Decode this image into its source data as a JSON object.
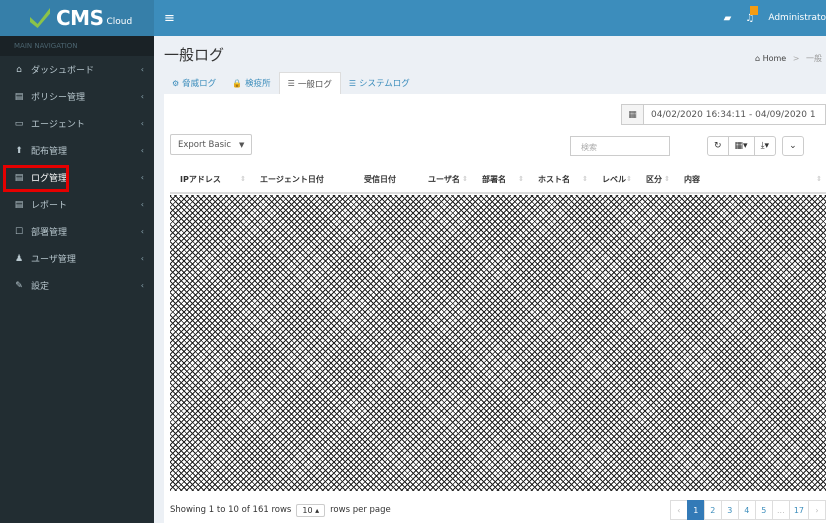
{
  "brand": {
    "name": "CMS",
    "sub": "Cloud"
  },
  "nav": {
    "header": "MAIN NAVIGATION",
    "items": [
      {
        "icon": "dashboard-icon",
        "glyph": "⌂",
        "label": "ダッシュボード",
        "chevron": "‹"
      },
      {
        "icon": "policy-icon",
        "glyph": "▤",
        "label": "ポリシー管理",
        "chevron": "‹"
      },
      {
        "icon": "agent-icon",
        "glyph": "▭",
        "label": "エージェント",
        "chevron": "‹"
      },
      {
        "icon": "deploy-icon",
        "glyph": "⬆",
        "label": "配布管理",
        "chevron": "‹"
      },
      {
        "icon": "log-icon",
        "glyph": "▤",
        "label": "ログ管理",
        "chevron": "‹"
      },
      {
        "icon": "report-icon",
        "glyph": "▤",
        "label": "レポート",
        "chevron": "‹"
      },
      {
        "icon": "department-icon",
        "glyph": "☐",
        "label": "部署管理",
        "chevron": "‹"
      },
      {
        "icon": "user-icon",
        "glyph": "♟",
        "label": "ユーザ管理",
        "chevron": "‹"
      },
      {
        "icon": "settings-icon",
        "glyph": "✎",
        "label": "設定",
        "chevron": "‹"
      }
    ]
  },
  "topbar": {
    "toggle": "≡",
    "admin": "Administrato"
  },
  "page": {
    "title": "一般ログ"
  },
  "breadcrumb": {
    "home": "Home",
    "sep": ">",
    "current": "一般"
  },
  "tabs": [
    {
      "glyph": "⚙",
      "label": "脅威ログ"
    },
    {
      "glyph": "🔒",
      "label": "検疫所"
    },
    {
      "glyph": "☰",
      "label": "一般ログ"
    },
    {
      "glyph": "☰",
      "label": "システムログ"
    }
  ],
  "daterange": {
    "value": "04/02/2020 16:34:11 - 04/09/2020 1"
  },
  "export": {
    "label": "Export Basic",
    "caret": "▼"
  },
  "search": {
    "placeholder": "検索"
  },
  "toolbar": {
    "refresh": "↻",
    "columns": "▦▾",
    "export": "⤓▾",
    "collapse": "⌄"
  },
  "table": {
    "columns": [
      "IPアドレス",
      "エージェント日付",
      "受信日付",
      "ユーザ名",
      "部署名",
      "ホスト名",
      "レベル",
      "区分",
      "内容"
    ]
  },
  "footer": {
    "showing": "Showing 1 to 10 of 161 rows",
    "rpp": "10 ▴",
    "rpp_suffix": "rows per page"
  },
  "pagination": {
    "prev": "‹",
    "pages": [
      "1",
      "2",
      "3",
      "4",
      "5",
      "...",
      "17"
    ],
    "next": "›",
    "active": "1"
  }
}
